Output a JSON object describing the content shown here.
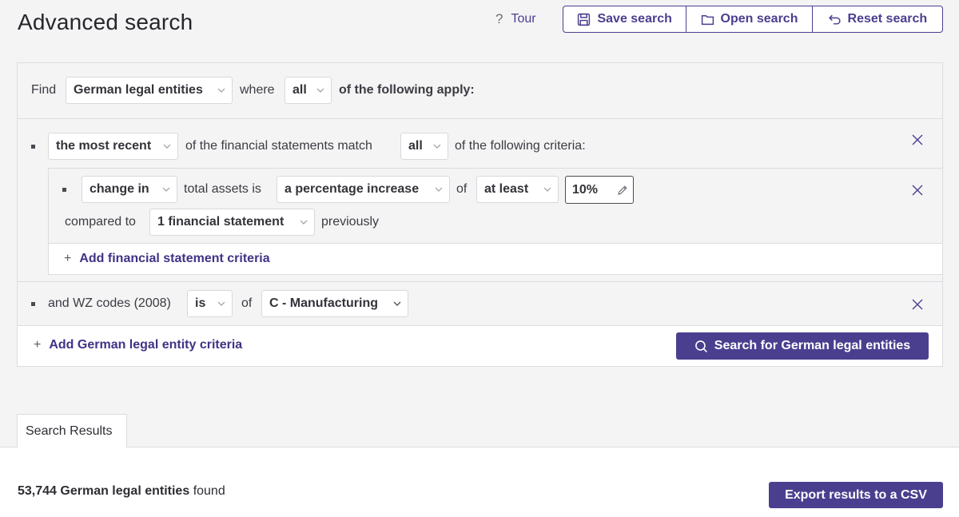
{
  "header": {
    "title": "Advanced search",
    "tour_label": "Tour",
    "buttons": {
      "save": "Save search",
      "open": "Open search",
      "reset": "Reset search"
    }
  },
  "find": {
    "prefix": "Find",
    "entity_type": "German legal entities",
    "where": "where",
    "quantifier": "all",
    "suffix": "of the following apply:"
  },
  "criteria_group": {
    "selector": "the most recent",
    "text1": "of the financial statements match",
    "quantifier": "all",
    "text2": "of the following criteria:",
    "criterion": {
      "mode": "change in",
      "field_text": "total assets is",
      "change_type": "a percentage increase",
      "of_text": "of",
      "comparator": "at least",
      "value": "10%",
      "compared_to_text": "compared to",
      "period": "1 financial statement",
      "previously_text": "previously"
    },
    "add_link": "Add financial statement criteria"
  },
  "wz_criterion": {
    "label": "and WZ codes (2008)",
    "operator": "is",
    "of_text": "of",
    "value": "C - Manufacturing"
  },
  "actions": {
    "add_entity_criteria": "Add German legal entity criteria",
    "search_button": "Search for German legal entities"
  },
  "results": {
    "tab_label": "Search Results",
    "count": "53,744",
    "entity_label": "German legal entities",
    "found_text": "found",
    "export_button": "Export results to a CSV"
  },
  "colors": {
    "accent": "#4a3f8f",
    "background": "#f4f4f5",
    "border": "#dcdce1"
  }
}
